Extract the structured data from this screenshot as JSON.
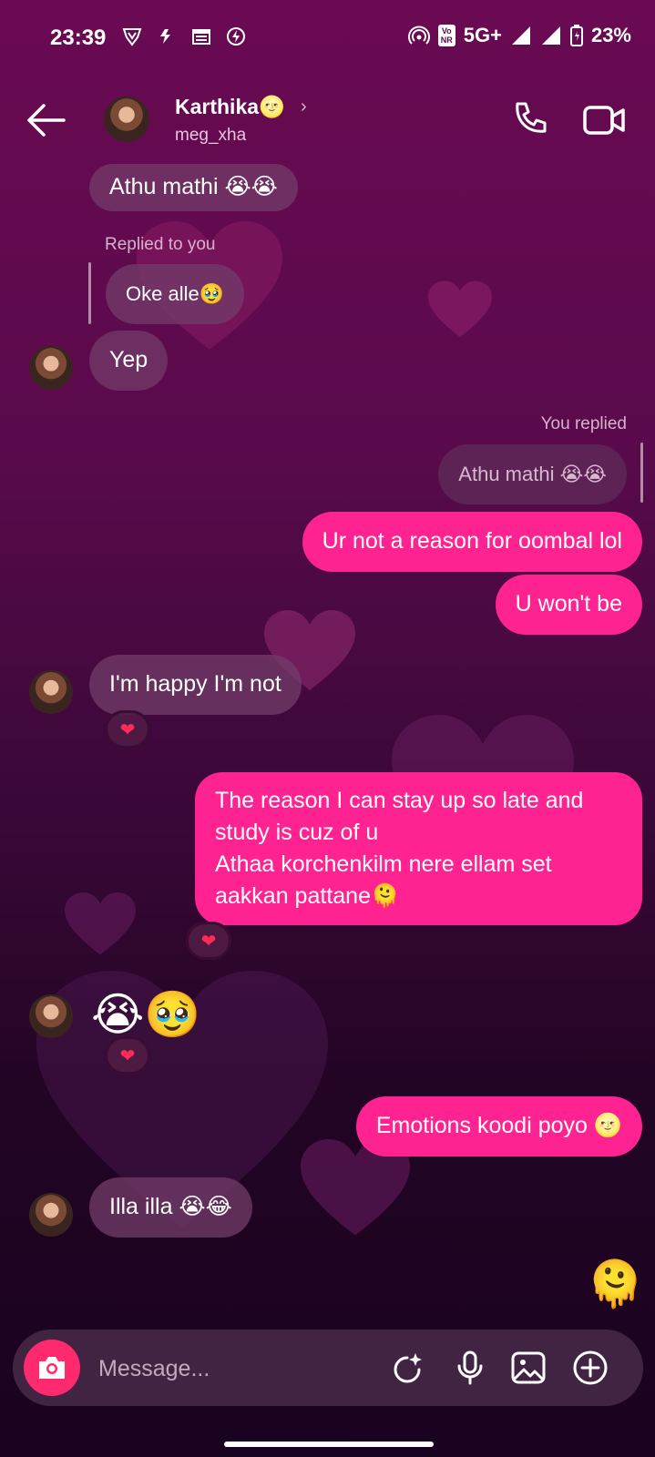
{
  "status_bar": {
    "time": "23:39",
    "network": "5G+",
    "battery": "23%",
    "icons": [
      "vpn-icon",
      "flash-icon",
      "calendar-icon",
      "power-icon",
      "hotspot-icon",
      "volte-icon",
      "signal-icon",
      "battery-icon"
    ],
    "volte_top": "Vo",
    "volte_bottom": "NR"
  },
  "header": {
    "name": "Karthika",
    "name_emoji": "🌝",
    "username": "meg_xha"
  },
  "messages": [
    {
      "text": "Athu mathi 😭😭"
    },
    {
      "meta": "Replied to you",
      "text": "Oke alle🥹"
    },
    {
      "text": "Yep"
    },
    {
      "meta": "You replied",
      "quoted": "Athu mathi 😭😭"
    },
    {
      "text": "Ur not a reason for oombal lol"
    },
    {
      "text": "U won't be"
    },
    {
      "text": "I'm happy I'm not",
      "reaction": "❤"
    },
    {
      "lines": [
        "The reason I can stay up so late and",
        "study is cuz of u",
        "Athaa korchenkilm nere ellam set",
        "aakkan pattane🫠"
      ],
      "reaction": "❤"
    },
    {
      "text": "😭🥹",
      "reaction": "❤"
    },
    {
      "text": "Emotions koodi poyo 🌝"
    },
    {
      "text": "Illa illa 😭😂"
    },
    {
      "text": "🫠"
    }
  ],
  "composer": {
    "placeholder": "Message..."
  },
  "colors": {
    "outgoing": "#ff2291",
    "background_top": "#6a0a52",
    "background_bottom": "#1a0320"
  }
}
